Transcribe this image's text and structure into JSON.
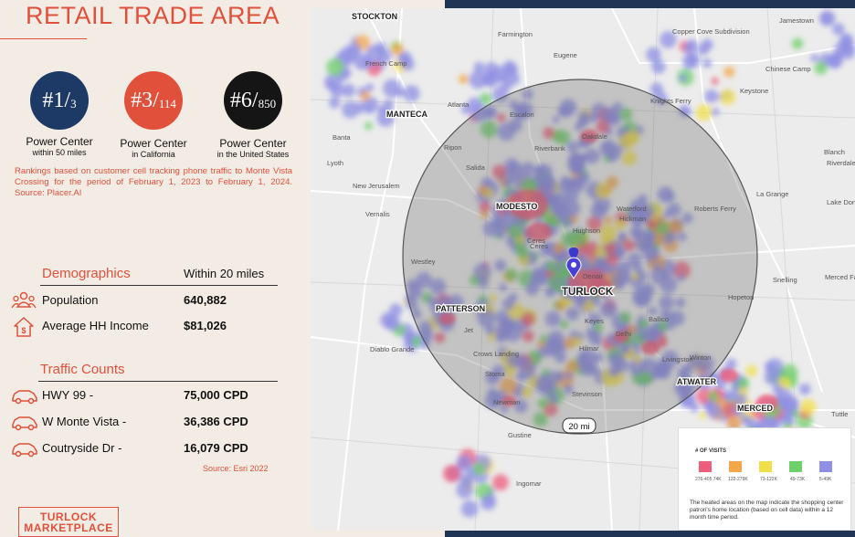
{
  "title": "RETAIL TRADE AREA",
  "rankings": [
    {
      "rank": "#1/",
      "of": "3",
      "label": "Power Center",
      "sub": "within 50 miles",
      "color": "#1d3a66"
    },
    {
      "rank": "#3/",
      "of": "114",
      "label": "Power Center",
      "sub": "in California",
      "color": "#e0503a"
    },
    {
      "rank": "#6/",
      "of": "850",
      "label": "Power Center",
      "sub": "in the United States",
      "color": "#151515"
    }
  ],
  "rankings_source": "Rankings based on customer cell tracking phone traffic to Monte Vista Crossing for the period of February 1, 2023 to February 1, 2024. Source: Placer.AI",
  "demographics": {
    "heading": "Demographics",
    "column": "Within 20 miles",
    "rows": [
      {
        "label": "Population",
        "value": "640,882",
        "icon": "people-icon"
      },
      {
        "label": "Average HH Income",
        "value": "$81,026",
        "icon": "house-dollar-icon"
      }
    ]
  },
  "traffic": {
    "heading": "Traffic Counts",
    "rows": [
      {
        "label": "HWY 99 -",
        "value": "75,000 CPD",
        "icon": "car-icon"
      },
      {
        "label": "W Monte Vista -",
        "value": "36,386 CPD",
        "icon": "car-icon"
      },
      {
        "label": "Coutryside Dr -",
        "value": "16,079 CPD",
        "icon": "car-icon"
      }
    ],
    "source": "Source: Esri 2022"
  },
  "logo": {
    "line1": "TURLOCK",
    "line2": "MARKETPLACE"
  },
  "map": {
    "radius_label": "20 mi",
    "city_labels": [
      "STOCKTON",
      "MANTECA",
      "MODESTO",
      "TURLOCK",
      "PATTERSON",
      "ATWATER",
      "MERCED"
    ],
    "place_labels": [
      "Farmington",
      "Jamestown",
      "Copper Cove Subdivision",
      "French Camp",
      "Eugene",
      "Chinese Camp",
      "Atlanta",
      "Escalon",
      "Knights Ferry",
      "Keystone",
      "Banta",
      "Ripon",
      "Oakdale",
      "Lyoth",
      "Riverbank",
      "Salida",
      "New Jerusalem",
      "Vernalis",
      "Waterford",
      "Hickman",
      "Roberts Ferry",
      "La Grange",
      "Riverdale",
      "Ceres",
      "Hughson",
      "Westley",
      "Denair",
      "Snelling",
      "Merced Falls",
      "Hopeton",
      "Keyes",
      "Ballico",
      "Diablo Grande",
      "Crows Landing",
      "Hilmar",
      "Delhi",
      "Livingston",
      "Winton",
      "Stevinson",
      "Newman",
      "Gustine",
      "Ingomar",
      "Tuttle",
      "Jet",
      "Blanch",
      "Lake Don Pedro",
      "Ceres",
      "Stoma"
    ],
    "legend_title": "# OF VISITS",
    "legend": [
      {
        "label": "276-405.74K",
        "color": "#ee5d7b"
      },
      {
        "label": "122-279K",
        "color": "#f3a74b"
      },
      {
        "label": "73-122K",
        "color": "#f2e04a"
      },
      {
        "label": "49-73K",
        "color": "#6fcf6b"
      },
      {
        "label": "5-49K",
        "color": "#8f8fe3"
      }
    ],
    "legend_note": "The heated areas on the map indicate the shopping center patron's home location (based on cell data) within a 12 month time period."
  }
}
